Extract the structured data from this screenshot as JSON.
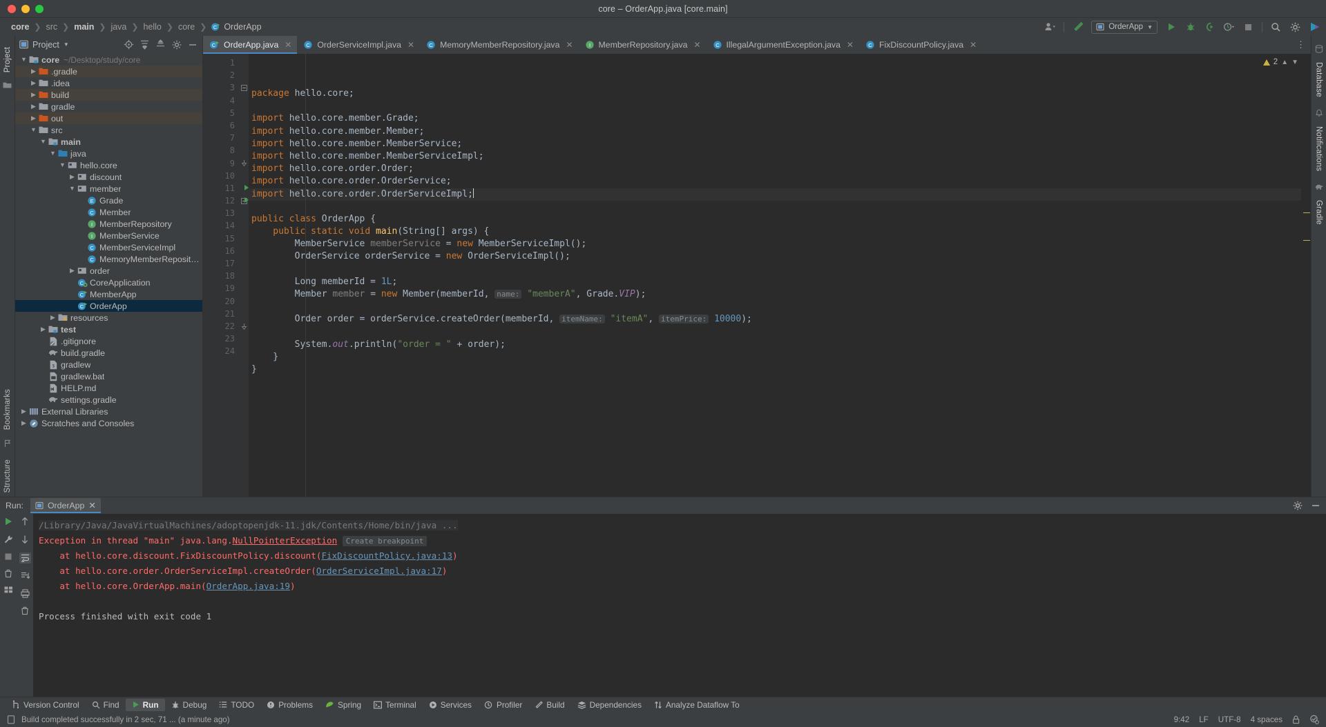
{
  "window": {
    "title": "core – OrderApp.java [core.main]"
  },
  "breadcrumb": {
    "items": [
      {
        "label": "core",
        "bold": true
      },
      {
        "label": "src",
        "bold": false
      },
      {
        "label": "main",
        "bold": true
      },
      {
        "label": "java",
        "bold": false
      },
      {
        "label": "hello",
        "bold": false
      },
      {
        "label": "core",
        "bold": false
      }
    ],
    "file": "OrderApp"
  },
  "toolbar": {
    "run_config": "OrderApp",
    "icons": [
      "user-icon",
      "build-hammer-icon",
      "run-icon",
      "debug-icon",
      "coverage-icon",
      "profiler-icon",
      "stop-icon",
      "search-everywhere-icon",
      "settings-gear-icon",
      "updates-icon"
    ]
  },
  "project_panel": {
    "title": "Project",
    "header_icons": [
      "locate-icon",
      "expand-all-icon",
      "collapse-all-icon",
      "settings-gear-icon",
      "hide-icon"
    ],
    "tree": [
      {
        "label": "core",
        "path": "~/Desktop/study/core",
        "indent": 0,
        "arrow": "down",
        "icon": "module-folder",
        "bold": true,
        "state": "normal"
      },
      {
        "label": ".gradle",
        "indent": 1,
        "arrow": "right",
        "icon": "excluded-folder",
        "state": "excluded"
      },
      {
        "label": ".idea",
        "indent": 1,
        "arrow": "right",
        "icon": "folder",
        "state": "normal"
      },
      {
        "label": "build",
        "indent": 1,
        "arrow": "right",
        "icon": "excluded-folder",
        "state": "excluded"
      },
      {
        "label": "gradle",
        "indent": 1,
        "arrow": "right",
        "icon": "folder",
        "state": "normal"
      },
      {
        "label": "out",
        "indent": 1,
        "arrow": "right",
        "icon": "excluded-folder",
        "state": "excluded"
      },
      {
        "label": "src",
        "indent": 1,
        "arrow": "down",
        "icon": "folder",
        "state": "normal"
      },
      {
        "label": "main",
        "indent": 2,
        "arrow": "down",
        "icon": "module-folder",
        "bold": true,
        "state": "normal"
      },
      {
        "label": "java",
        "indent": 3,
        "arrow": "down",
        "icon": "source-folder",
        "state": "normal"
      },
      {
        "label": "hello.core",
        "indent": 4,
        "arrow": "down",
        "icon": "package",
        "state": "normal"
      },
      {
        "label": "discount",
        "indent": 5,
        "arrow": "right",
        "icon": "package",
        "state": "normal"
      },
      {
        "label": "member",
        "indent": 5,
        "arrow": "down",
        "icon": "package",
        "state": "normal"
      },
      {
        "label": "Grade",
        "indent": 6,
        "arrow": "none",
        "icon": "enum",
        "state": "normal"
      },
      {
        "label": "Member",
        "indent": 6,
        "arrow": "none",
        "icon": "class",
        "state": "normal"
      },
      {
        "label": "MemberRepository",
        "indent": 6,
        "arrow": "none",
        "icon": "interface",
        "state": "normal"
      },
      {
        "label": "MemberService",
        "indent": 6,
        "arrow": "none",
        "icon": "interface",
        "state": "normal"
      },
      {
        "label": "MemberServiceImpl",
        "indent": 6,
        "arrow": "none",
        "icon": "class",
        "state": "normal"
      },
      {
        "label": "MemoryMemberRepository",
        "indent": 6,
        "arrow": "none",
        "icon": "class",
        "state": "normal"
      },
      {
        "label": "order",
        "indent": 5,
        "arrow": "right",
        "icon": "package",
        "state": "normal"
      },
      {
        "label": "CoreApplication",
        "indent": 5,
        "arrow": "none",
        "icon": "spring-class",
        "state": "normal"
      },
      {
        "label": "MemberApp",
        "indent": 5,
        "arrow": "none",
        "icon": "runnable-class",
        "state": "normal"
      },
      {
        "label": "OrderApp",
        "indent": 5,
        "arrow": "none",
        "icon": "runnable-class",
        "state": "selected"
      },
      {
        "label": "resources",
        "indent": 3,
        "arrow": "right",
        "icon": "resources-folder",
        "state": "normal"
      },
      {
        "label": "test",
        "indent": 2,
        "arrow": "right",
        "icon": "test-folder",
        "bold": true,
        "state": "normal"
      },
      {
        "label": ".gitignore",
        "indent": 2,
        "arrow": "none",
        "icon": "gitignore-file",
        "state": "normal"
      },
      {
        "label": "build.gradle",
        "indent": 2,
        "arrow": "none",
        "icon": "gradle-file",
        "state": "normal"
      },
      {
        "label": "gradlew",
        "indent": 2,
        "arrow": "none",
        "icon": "script-file",
        "state": "normal"
      },
      {
        "label": "gradlew.bat",
        "indent": 2,
        "arrow": "none",
        "icon": "bat-file",
        "state": "normal"
      },
      {
        "label": "HELP.md",
        "indent": 2,
        "arrow": "none",
        "icon": "markdown-file",
        "state": "normal"
      },
      {
        "label": "settings.gradle",
        "indent": 2,
        "arrow": "none",
        "icon": "gradle-file",
        "state": "normal"
      },
      {
        "label": "External Libraries",
        "indent": 0,
        "arrow": "right",
        "icon": "libraries",
        "state": "normal"
      },
      {
        "label": "Scratches and Consoles",
        "indent": 0,
        "arrow": "right",
        "icon": "scratches",
        "state": "normal"
      }
    ]
  },
  "editor": {
    "tabs": [
      {
        "label": "OrderApp.java",
        "icon": "runnable-class",
        "active": true
      },
      {
        "label": "OrderServiceImpl.java",
        "icon": "class",
        "active": false
      },
      {
        "label": "MemoryMemberRepository.java",
        "icon": "class",
        "active": false
      },
      {
        "label": "MemberRepository.java",
        "icon": "interface",
        "active": false
      },
      {
        "label": "IllegalArgumentException.java",
        "icon": "class",
        "active": false
      },
      {
        "label": "FixDiscountPolicy.java",
        "icon": "class",
        "active": false
      }
    ],
    "inspection": {
      "warning_count": "2"
    },
    "first_line": 1,
    "last_line": 24,
    "current_line": 9,
    "lines": [
      {
        "n": 1,
        "tokens": [
          {
            "t": "package ",
            "c": "kw"
          },
          {
            "t": "hello.core;",
            "c": "local"
          }
        ]
      },
      {
        "n": 2,
        "tokens": []
      },
      {
        "n": 3,
        "fold": "start",
        "tokens": [
          {
            "t": "import ",
            "c": "kw"
          },
          {
            "t": "hello.core.member.Grade;",
            "c": "local"
          }
        ]
      },
      {
        "n": 4,
        "tokens": [
          {
            "t": "import ",
            "c": "kw"
          },
          {
            "t": "hello.core.member.Member;",
            "c": "local"
          }
        ]
      },
      {
        "n": 5,
        "tokens": [
          {
            "t": "import ",
            "c": "kw"
          },
          {
            "t": "hello.core.member.MemberService;",
            "c": "local"
          }
        ]
      },
      {
        "n": 6,
        "tokens": [
          {
            "t": "import ",
            "c": "kw"
          },
          {
            "t": "hello.core.member.MemberServiceImpl;",
            "c": "local"
          }
        ]
      },
      {
        "n": 7,
        "tokens": [
          {
            "t": "import ",
            "c": "kw"
          },
          {
            "t": "hello.core.order.Order;",
            "c": "local"
          }
        ]
      },
      {
        "n": 8,
        "tokens": [
          {
            "t": "import ",
            "c": "kw"
          },
          {
            "t": "hello.core.order.OrderService;",
            "c": "local"
          }
        ]
      },
      {
        "n": 9,
        "fold": "end",
        "current": true,
        "caret": true,
        "tokens": [
          {
            "t": "import ",
            "c": "kw"
          },
          {
            "t": "hello.core.order.OrderServiceImpl;",
            "c": "local"
          }
        ]
      },
      {
        "n": 10,
        "tokens": []
      },
      {
        "n": 11,
        "run": true,
        "tokens": [
          {
            "t": "public class ",
            "c": "kw"
          },
          {
            "t": "OrderApp {",
            "c": "local"
          }
        ]
      },
      {
        "n": 12,
        "run": true,
        "fold": "start",
        "tokens": [
          {
            "t": "    public static void ",
            "c": "kw"
          },
          {
            "t": "main",
            "c": "meth"
          },
          {
            "t": "(String[] args) {",
            "c": "local"
          }
        ]
      },
      {
        "n": 13,
        "tokens": [
          {
            "t": "        MemberService ",
            "c": "local"
          },
          {
            "t": "memberService",
            "c": "gray"
          },
          {
            "t": " = ",
            "c": "local"
          },
          {
            "t": "new ",
            "c": "kw"
          },
          {
            "t": "MemberServiceImpl();",
            "c": "local"
          }
        ]
      },
      {
        "n": 14,
        "tokens": [
          {
            "t": "        OrderService orderService = ",
            "c": "local"
          },
          {
            "t": "new ",
            "c": "kw"
          },
          {
            "t": "OrderServiceImpl();",
            "c": "local"
          }
        ]
      },
      {
        "n": 15,
        "tokens": []
      },
      {
        "n": 16,
        "tokens": [
          {
            "t": "        Long memberId = ",
            "c": "local"
          },
          {
            "t": "1L",
            "c": "num"
          },
          {
            "t": ";",
            "c": "local"
          }
        ]
      },
      {
        "n": 17,
        "tokens": [
          {
            "t": "        Member ",
            "c": "local"
          },
          {
            "t": "member",
            "c": "gray"
          },
          {
            "t": " = ",
            "c": "local"
          },
          {
            "t": "new ",
            "c": "kw"
          },
          {
            "t": "Member(memberId, ",
            "c": "local"
          },
          {
            "t": "name:",
            "c": "hint"
          },
          {
            "t": " ",
            "c": "local"
          },
          {
            "t": "\"memberA\"",
            "c": "str"
          },
          {
            "t": ", Grade.",
            "c": "local"
          },
          {
            "t": "VIP",
            "c": "fld"
          },
          {
            "t": ");",
            "c": "local"
          }
        ]
      },
      {
        "n": 18,
        "tokens": []
      },
      {
        "n": 19,
        "tokens": [
          {
            "t": "        Order order = orderService.createOrder(memberId, ",
            "c": "local"
          },
          {
            "t": "itemName:",
            "c": "hint"
          },
          {
            "t": " ",
            "c": "local"
          },
          {
            "t": "\"itemA\"",
            "c": "str"
          },
          {
            "t": ", ",
            "c": "local"
          },
          {
            "t": "itemPrice:",
            "c": "hint"
          },
          {
            "t": " ",
            "c": "local"
          },
          {
            "t": "10000",
            "c": "num"
          },
          {
            "t": ");",
            "c": "local"
          }
        ]
      },
      {
        "n": 20,
        "tokens": []
      },
      {
        "n": 21,
        "tokens": [
          {
            "t": "        System.",
            "c": "local"
          },
          {
            "t": "out",
            "c": "fld"
          },
          {
            "t": ".println(",
            "c": "local"
          },
          {
            "t": "\"order = \"",
            "c": "str"
          },
          {
            "t": " + order);",
            "c": "local"
          }
        ]
      },
      {
        "n": 22,
        "fold": "end",
        "tokens": [
          {
            "t": "    }",
            "c": "local"
          }
        ]
      },
      {
        "n": 23,
        "tokens": [
          {
            "t": "}",
            "c": "local"
          }
        ]
      },
      {
        "n": 24,
        "tokens": []
      }
    ]
  },
  "run_window": {
    "label": "Run:",
    "tab": "OrderApp",
    "left_icons": [
      "rerun-icon",
      "settings-wrench-icon",
      "stop-icon",
      "trash-icon",
      "bookmarks-icon"
    ],
    "side_icons": [
      "scroll-up-icon",
      "scroll-down-icon",
      "soft-wrap-icon",
      "scroll-to-end-icon",
      "print-icon",
      "clear-all-icon"
    ],
    "header_icons": [
      "settings-gear-icon",
      "hide-icon"
    ],
    "console": [
      {
        "kind": "command",
        "text": "/Library/Java/JavaVirtualMachines/adoptopenjdk-11.jdk/Contents/Home/bin/java ..."
      },
      {
        "kind": "exception",
        "prefix": "Exception in thread \"main\" java.lang.",
        "link": "NullPointerException",
        "chip": "Create breakpoint"
      },
      {
        "kind": "frame",
        "text": "    at hello.core.discount.FixDiscountPolicy.discount(",
        "link": "FixDiscountPolicy.java:13",
        "suffix": ")"
      },
      {
        "kind": "frame",
        "text": "    at hello.core.order.OrderServiceImpl.createOrder(",
        "link": "OrderServiceImpl.java:17",
        "suffix": ")"
      },
      {
        "kind": "frame",
        "text": "    at hello.core.OrderApp.main(",
        "link": "OrderApp.java:19",
        "suffix": ")"
      },
      {
        "kind": "blank",
        "text": ""
      },
      {
        "kind": "plain",
        "text": "Process finished with exit code 1"
      }
    ]
  },
  "bottom_toolbar": {
    "items": [
      {
        "label": "Version Control",
        "icon": "branch-icon",
        "active": false
      },
      {
        "label": "Find",
        "icon": "search-icon",
        "active": false
      },
      {
        "label": "Run",
        "icon": "run-icon",
        "active": true
      },
      {
        "label": "Debug",
        "icon": "debug-icon",
        "active": false
      },
      {
        "label": "TODO",
        "icon": "todo-icon",
        "active": false
      },
      {
        "label": "Problems",
        "icon": "problems-icon",
        "active": false
      },
      {
        "label": "Spring",
        "icon": "spring-icon",
        "active": false
      },
      {
        "label": "Terminal",
        "icon": "terminal-icon",
        "active": false
      },
      {
        "label": "Services",
        "icon": "services-icon",
        "active": false
      },
      {
        "label": "Profiler",
        "icon": "profiler-icon",
        "active": false
      },
      {
        "label": "Build",
        "icon": "build-hammer-icon",
        "active": false
      },
      {
        "label": "Dependencies",
        "icon": "dependencies-icon",
        "active": false
      },
      {
        "label": "Analyze Dataflow To",
        "icon": "dataflow-icon",
        "active": false
      }
    ]
  },
  "status_bar": {
    "message": "Build completed successfully in 2 sec, 71 ... (a minute ago)",
    "caret_position": "9:42",
    "line_separator": "LF",
    "encoding": "UTF-8",
    "indent": "4 spaces",
    "icons": [
      "memory-icon",
      "lock-icon",
      "inspection-icon"
    ]
  },
  "right_rail": {
    "items": [
      "Database",
      "Notifications",
      "Gradle"
    ]
  },
  "left_rail": {
    "items": [
      "Project",
      "Bookmarks",
      "Structure"
    ]
  },
  "colors": {
    "accent": "#4a88c7",
    "bg": "#3c3f41",
    "editor_bg": "#2b2b2b",
    "keyword": "#cc7832",
    "string": "#6a8759",
    "number": "#6897bb",
    "field": "#9876aa",
    "method": "#ffc66d",
    "error": "#ff6b68",
    "selection": "#0d293e"
  }
}
